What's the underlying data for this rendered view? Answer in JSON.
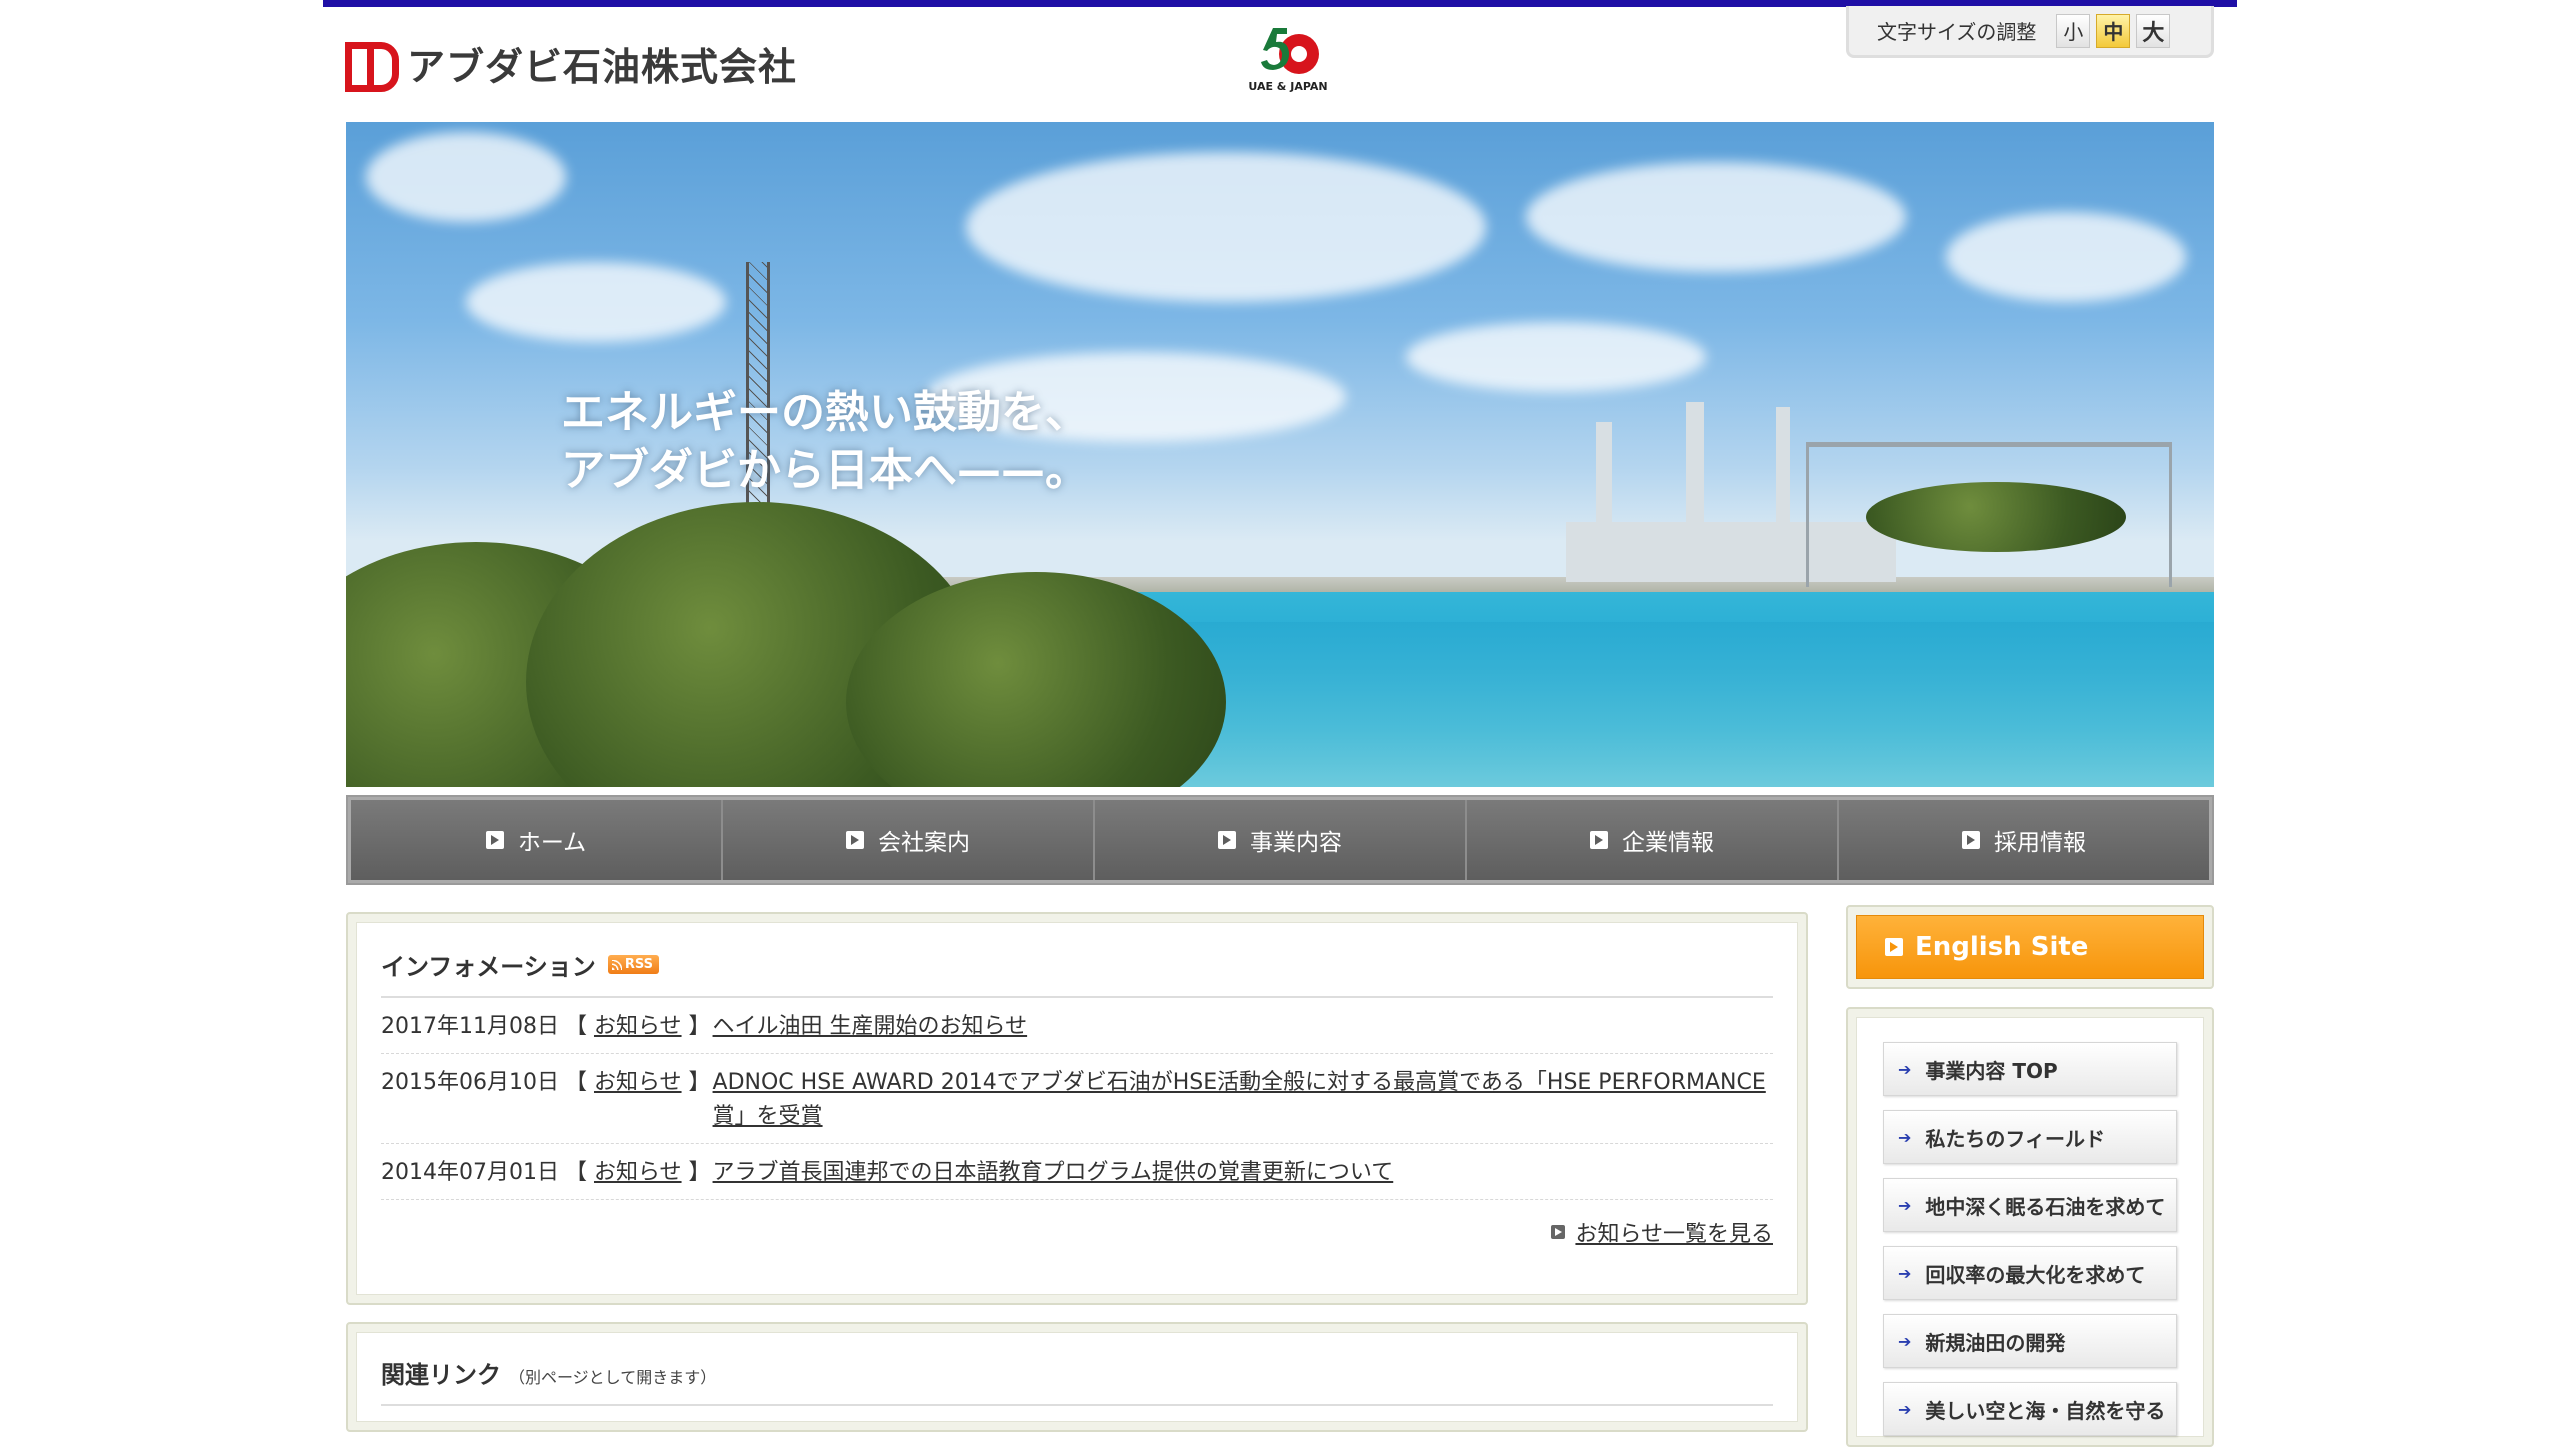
{
  "header": {
    "company_name": "アブダビ石油株式会社",
    "anniversary_number": "50",
    "anniversary_caption": "UAE & JAPAN",
    "font_size_label": "文字サイズの調整",
    "font_size_options": [
      "小",
      "中",
      "大"
    ],
    "font_size_selected": "中"
  },
  "hero": {
    "line1": "エネルギーの熱い鼓動を、",
    "line2": "アブダビから日本へ——。"
  },
  "nav": {
    "items": [
      "ホーム",
      "会社案内",
      "事業内容",
      "企業情報",
      "採用情報"
    ]
  },
  "info": {
    "title": "インフォメーション",
    "rss_label": "RSS",
    "news": [
      {
        "date": "2017年11月08日",
        "category": "お知らせ",
        "title": "ヘイル油田 生産開始のお知らせ"
      },
      {
        "date": "2015年06月10日",
        "category": "お知らせ",
        "title": "ADNOC HSE AWARD 2014でアブダビ石油がHSE活動全般に対する最高賞である「HSE PERFORMANCE賞」を受賞"
      },
      {
        "date": "2014年07月01日",
        "category": "お知らせ",
        "title": "アラブ首長国連邦での日本語教育プログラム提供の覚書更新について"
      }
    ],
    "more_label": "お知らせ一覧を見る"
  },
  "related": {
    "title": "関連リンク",
    "note": "（別ページとして開きます）"
  },
  "sidebar": {
    "english_label": "English Site",
    "items": [
      "事業内容 TOP",
      "私たちのフィールド",
      "地中深く眠る石油を求めて",
      "回収率の最大化を求めて",
      "新規油田の開発",
      "美しい空と海・自然を守る"
    ]
  },
  "colors": {
    "top_bar": "#1f0fa6",
    "logo_red": "#d7141c",
    "english_orange": "#f7950b",
    "nav_gray": "#6a6a6a"
  }
}
